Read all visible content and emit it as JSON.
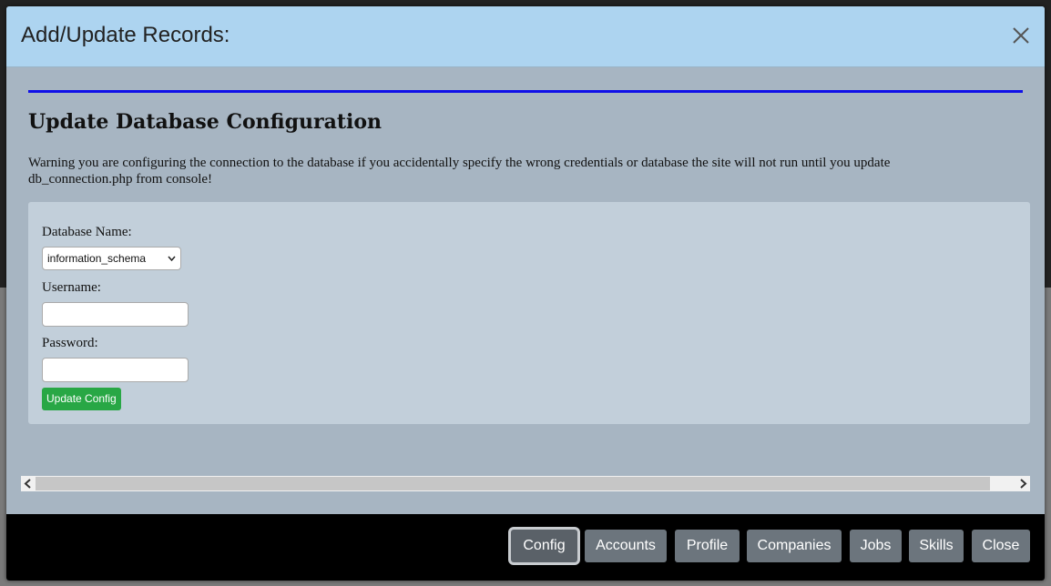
{
  "modal": {
    "title": "Add/Update Records:",
    "close_icon": "close-icon"
  },
  "section": {
    "title": "Update Database Configuration",
    "warning": "Warning you are configuring the connection to the database if you accidentally specify the wrong credentials or database the site will not run until you update db_connection.php from console!"
  },
  "form": {
    "database_label": "Database Name:",
    "database_selected": "information_schema",
    "username_label": "Username:",
    "username_value": "",
    "password_label": "Password:",
    "password_value": "",
    "submit_label": "Update Config"
  },
  "footer": {
    "buttons": [
      {
        "label": "Config",
        "active": true
      },
      {
        "label": "Accounts"
      },
      {
        "label": "Profile"
      },
      {
        "label": "Companies"
      },
      {
        "label": "Jobs"
      },
      {
        "label": "Skills"
      },
      {
        "label": "Close"
      }
    ]
  },
  "colors": {
    "header_bg": "#add4f0",
    "body_bg": "#a7b5c2",
    "rule": "#1010e8",
    "submit_bg": "#28a745",
    "footer_btn_bg": "#6c757d"
  }
}
